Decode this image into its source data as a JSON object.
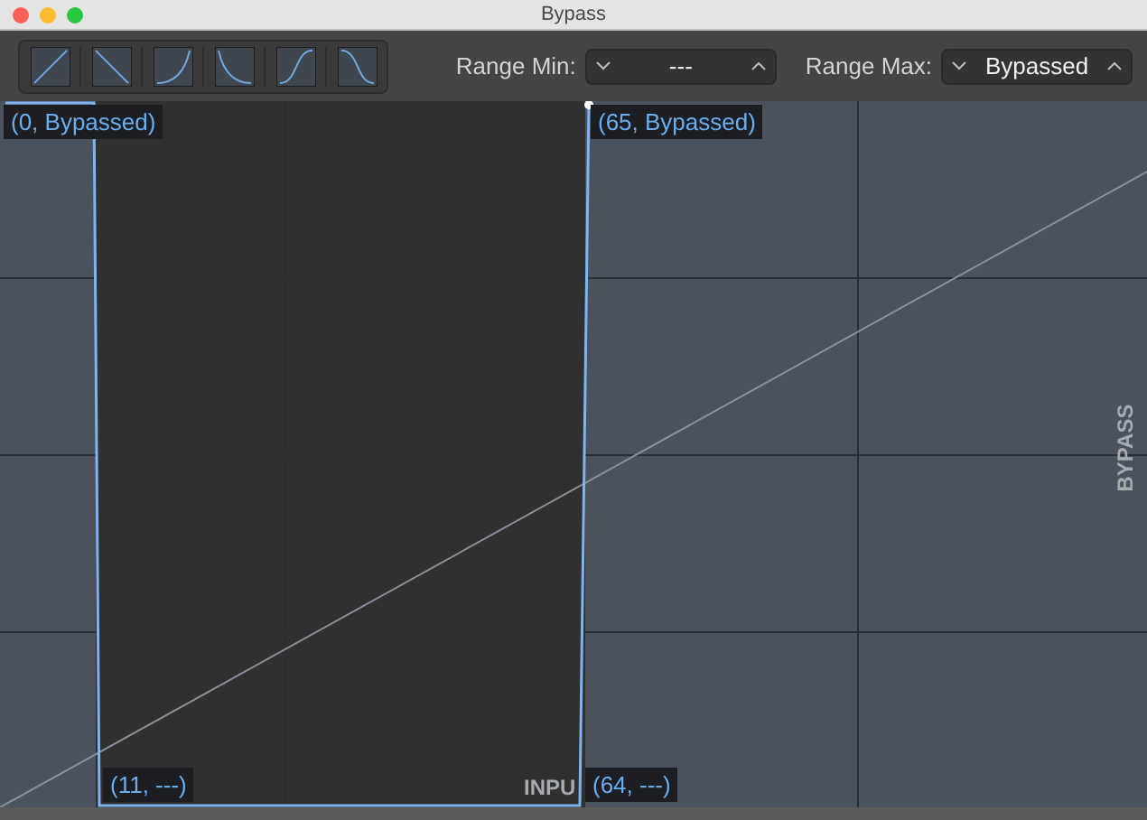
{
  "window": {
    "title": "Bypass"
  },
  "curve_buttons": [
    {
      "kind": "rise"
    },
    {
      "kind": "fall"
    },
    {
      "kind": "exp"
    },
    {
      "kind": "decay"
    },
    {
      "kind": "scurve"
    },
    {
      "kind": "bell"
    }
  ],
  "range_min": {
    "label": "Range Min:",
    "value": "---"
  },
  "range_max": {
    "label": "Range Max:",
    "value": "Bypassed"
  },
  "graph": {
    "y_label": "BYPASS",
    "x_label": "INPU",
    "points": [
      {
        "text": "(0, Bypassed)"
      },
      {
        "text": "(65, Bypassed)"
      },
      {
        "text": "(11, ---)"
      },
      {
        "text": "(64, ---)"
      }
    ]
  }
}
